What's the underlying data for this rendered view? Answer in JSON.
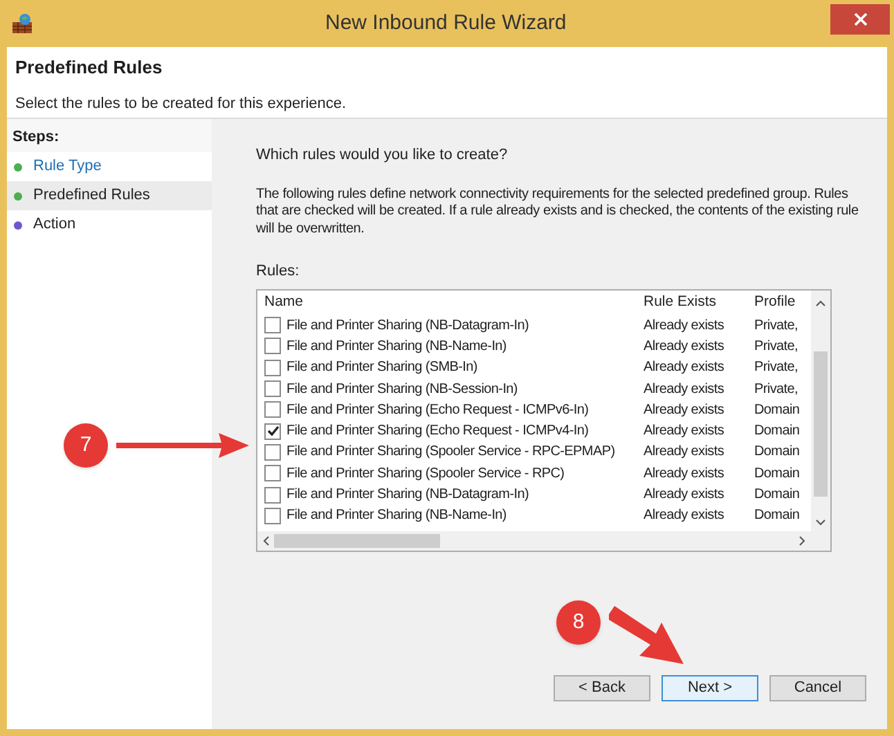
{
  "window": {
    "title": "New Inbound Rule Wizard"
  },
  "header": {
    "title": "Predefined Rules",
    "subtitle": "Select the rules to be created for this experience."
  },
  "sidebar": {
    "heading": "Steps:",
    "steps": [
      {
        "label": "Rule Type",
        "selected": false,
        "link": true,
        "color": "#4caf50"
      },
      {
        "label": "Predefined Rules",
        "selected": true,
        "link": false,
        "color": "#4caf50"
      },
      {
        "label": "Action",
        "selected": false,
        "link": false,
        "color": "#6a5acd"
      }
    ]
  },
  "content": {
    "question": "Which rules would you like to create?",
    "description": "The following rules define network connectivity requirements for the selected predefined group. Rules that are checked will be created. If a rule already exists and is checked, the contents of the existing rule will be overwritten.",
    "rules_label": "Rules:",
    "columns": [
      "Name",
      "Rule Exists",
      "Profile"
    ],
    "rows": [
      {
        "name": "File and Printer Sharing (NB-Datagram-In)",
        "rule_exists": "Already exists",
        "profile": "Private,",
        "checked": false
      },
      {
        "name": "File and Printer Sharing (NB-Name-In)",
        "rule_exists": "Already exists",
        "profile": "Private,",
        "checked": false
      },
      {
        "name": "File and Printer Sharing (SMB-In)",
        "rule_exists": "Already exists",
        "profile": "Private,",
        "checked": false
      },
      {
        "name": "File and Printer Sharing (NB-Session-In)",
        "rule_exists": "Already exists",
        "profile": "Private,",
        "checked": false
      },
      {
        "name": "File and Printer Sharing (Echo Request - ICMPv6-In)",
        "rule_exists": "Already exists",
        "profile": "Domain",
        "checked": false
      },
      {
        "name": "File and Printer Sharing (Echo Request - ICMPv4-In)",
        "rule_exists": "Already exists",
        "profile": "Domain",
        "checked": true
      },
      {
        "name": "File and Printer Sharing (Spooler Service - RPC-EPMAP)",
        "rule_exists": "Already exists",
        "profile": "Domain",
        "checked": false
      },
      {
        "name": "File and Printer Sharing (Spooler Service - RPC)",
        "rule_exists": "Already exists",
        "profile": "Domain",
        "checked": false
      },
      {
        "name": "File and Printer Sharing (NB-Datagram-In)",
        "rule_exists": "Already exists",
        "profile": "Domain",
        "checked": false
      },
      {
        "name": "File and Printer Sharing (NB-Name-In)",
        "rule_exists": "Already exists",
        "profile": "Domain",
        "checked": false
      }
    ]
  },
  "buttons": [
    {
      "label": "< Back",
      "focused": false
    },
    {
      "label": "Next >",
      "focused": true
    },
    {
      "label": "Cancel",
      "focused": false
    }
  ],
  "annotations": [
    {
      "label": "7"
    },
    {
      "label": "8"
    }
  ]
}
